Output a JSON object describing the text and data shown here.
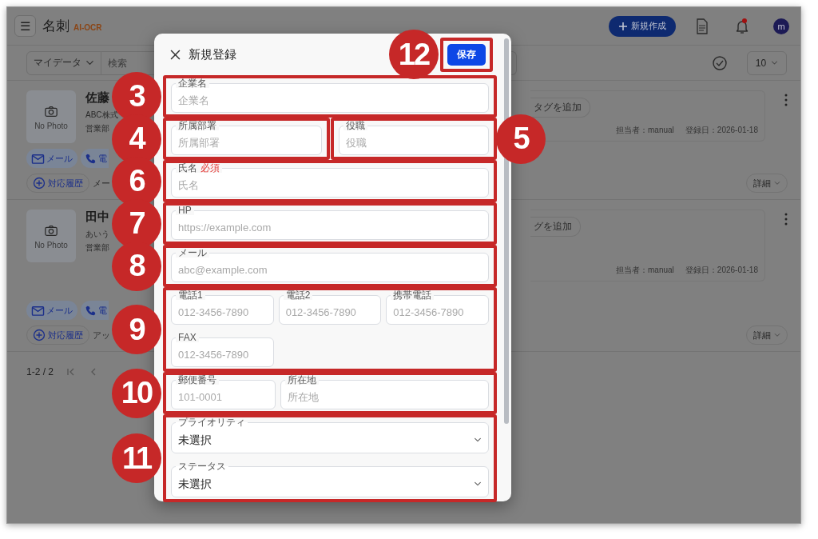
{
  "header": {
    "menu": "☰",
    "title": "名刺",
    "subtitle": "AI-OCR",
    "new_button": "新規作成",
    "has_notification": true,
    "avatar": "m"
  },
  "toolbar": {
    "scope": "マイデータ",
    "search_placeholder": "検索",
    "page_size": "10"
  },
  "cards": [
    {
      "photo": "No Photo",
      "name": "佐藤",
      "company": "ABC株式",
      "department": "営業部",
      "mail_button": "メール",
      "phone_button": "電",
      "history_button": "対応履歴",
      "note": "メー",
      "tag_button": "タグを追加",
      "owner": "担当者：manual",
      "registered": "登録日：2026-01-18",
      "detail_button": "詳細"
    },
    {
      "photo": "No Photo",
      "name": "田中",
      "company": "あいう",
      "department": "営業部",
      "mail_button": "メール",
      "phone_button": "電",
      "history_button": "対応履歴",
      "note": "アッ",
      "tag_button": "グを追加",
      "owner": "担当者：manual",
      "registered": "登録日：2026-01-18",
      "detail_button": "詳細"
    }
  ],
  "pagination": {
    "range": "1-2 / 2"
  },
  "dialog": {
    "title": "新規登録",
    "save_button": "保存",
    "save_marker": "12",
    "rows": [
      {
        "boxes": [
          {
            "marker": "3",
            "kind": "stack",
            "fields": [
              {
                "kind": "text",
                "label": "企業名",
                "placeholder": "企業名"
              }
            ]
          }
        ]
      },
      {
        "boxes": [
          {
            "marker": "4",
            "kind": "stack",
            "fields": [
              {
                "kind": "text",
                "label": "所属部署",
                "placeholder": "所属部署"
              }
            ]
          },
          {
            "marker": "5",
            "kind": "stack",
            "fields": [
              {
                "kind": "text",
                "label": "役職",
                "placeholder": "役職"
              }
            ]
          }
        ]
      },
      {
        "boxes": [
          {
            "marker": "6",
            "kind": "stack",
            "fields": [
              {
                "kind": "text",
                "label": "氏名",
                "required_label": "必須",
                "placeholder": "氏名"
              }
            ]
          }
        ]
      },
      {
        "boxes": [
          {
            "marker": "7",
            "kind": "stack",
            "fields": [
              {
                "kind": "text",
                "label": "HP",
                "placeholder": "https://example.com"
              }
            ]
          }
        ]
      },
      {
        "boxes": [
          {
            "marker": "8",
            "kind": "stack",
            "fields": [
              {
                "kind": "text",
                "label": "メール",
                "placeholder": "abc@example.com"
              }
            ]
          }
        ]
      },
      {
        "boxes": [
          {
            "marker": "9",
            "kind": "triple",
            "fields": [
              {
                "kind": "text",
                "label": "電話1",
                "placeholder": "012-3456-7890"
              },
              {
                "kind": "text",
                "label": "電話2",
                "placeholder": "012-3456-7890"
              },
              {
                "kind": "text",
                "label": "携帯電話",
                "placeholder": "012-3456-7890"
              },
              {
                "kind": "text",
                "label": "FAX",
                "placeholder": "012-3456-7890"
              }
            ]
          }
        ]
      },
      {
        "boxes": [
          {
            "marker": "10",
            "kind": "address",
            "fields": [
              {
                "kind": "text",
                "label": "郵便番号",
                "placeholder": "101-0001"
              },
              {
                "kind": "text",
                "label": "所在地",
                "placeholder": "所在地"
              }
            ]
          }
        ]
      },
      {
        "boxes": [
          {
            "marker": "11",
            "kind": "stack",
            "fields": [
              {
                "kind": "select",
                "label": "プライオリティ",
                "value": "未選択"
              },
              {
                "kind": "select",
                "label": "ステータス",
                "value": "未選択"
              }
            ]
          }
        ]
      }
    ]
  }
}
